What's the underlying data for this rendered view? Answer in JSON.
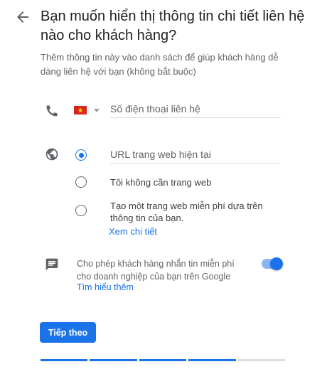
{
  "header": {
    "title": "Bạn muốn hiển thị thông tin chi tiết liên hệ nào cho khách hàng?",
    "subtitle": "Thêm thông tin này vào danh sách để giúp khách hàng dễ dàng liên hệ với bạn (không bắt buộc)"
  },
  "phone": {
    "icon": "phone-icon",
    "country": "Vietnam",
    "placeholder": "Số điện thoại liên hệ",
    "value": ""
  },
  "website": {
    "icon": "globe-icon",
    "selected": 0,
    "url_placeholder": "URL trang web hiện tại",
    "options": [
      "",
      "Tôi không cần trang web",
      "Tạo một trang web miễn phí dựa trên thông tin của bạn."
    ],
    "learn_more": "Xem chi tiết"
  },
  "chat": {
    "icon": "chat-message-icon",
    "text": "Cho phép khách hàng nhắn tin miễn phí cho doanh nghiệp của bạn trên Google",
    "learn_more": "Tìm hiểu thêm",
    "enabled": true
  },
  "footer": {
    "next_label": "Tiếp theo",
    "progress_completed": 4,
    "progress_total": 5
  },
  "colors": {
    "accent": "#1a73e8",
    "flag": "#da251d"
  }
}
